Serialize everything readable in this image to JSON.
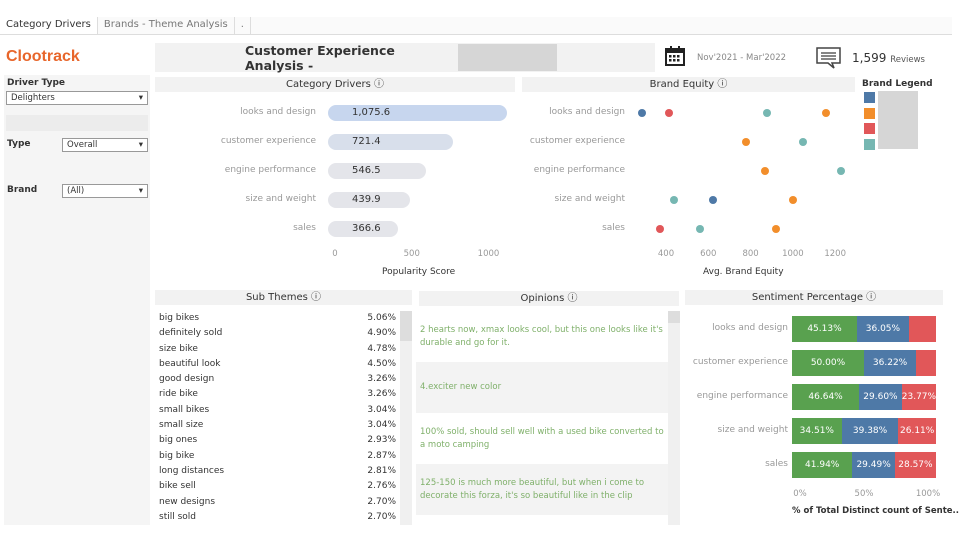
{
  "tabs": [
    {
      "label": "Category Drivers",
      "active": true
    },
    {
      "label": "Brands - Theme Analysis"
    },
    {
      "label": "."
    }
  ],
  "logo": "Clootrack",
  "filters": {
    "driver_type_label": "Driver Type",
    "driver_type_value": "Delighters",
    "type_label": "Type",
    "type_value": "Overall",
    "brand_label": "Brand",
    "brand_value": "(All)"
  },
  "header": {
    "title": "Customer Experience Analysis -",
    "date_range": "Nov'2021 - Mar'2022",
    "review_count": "1,599",
    "reviews_label": "Reviews"
  },
  "icons": {
    "calendar": "calendar-icon",
    "reviews": "speech-bubble-icon",
    "dropdown": "caret-down-icon",
    "info": "info-icon"
  },
  "colors": {
    "brand1": "#4e79a7",
    "brand2": "#f28e2b",
    "brand3": "#e15759",
    "brand4": "#76b7b2",
    "positive": "#59a14f",
    "neutral": "#4e79a7",
    "negative": "#e15759",
    "accent": "#e8662b"
  },
  "chart_data": [
    {
      "type": "bar",
      "title": "Category Drivers ⓘ",
      "categories": [
        "looks and design",
        "customer experience",
        "engine performance",
        "size and weight",
        "sales"
      ],
      "values": [
        1075.6,
        721.4,
        546.5,
        439.9,
        366.6
      ],
      "value_labels": [
        "1,075.6",
        "721.4",
        "546.5",
        "439.9",
        "366.6"
      ],
      "xlabel": "Popularity Score",
      "xticks": [
        "0",
        "500",
        "1000"
      ],
      "xlim": [
        0,
        1150
      ]
    },
    {
      "type": "scatter",
      "title": "Brand Equity ⓘ",
      "categories": [
        "looks and design",
        "customer experience",
        "engine performance",
        "size and weight",
        "sales"
      ],
      "xlabel": "Avg. Brand Equity",
      "xticks": [
        "400",
        "600",
        "800",
        "1000",
        "1200"
      ],
      "xlim": [
        290,
        1240
      ],
      "series": [
        {
          "color": "#4e79a7",
          "values": [
            287,
            null,
            null,
            622,
            null
          ]
        },
        {
          "color": "#f28e2b",
          "values": [
            1155,
            776,
            870,
            1000,
            920
          ]
        },
        {
          "color": "#e15759",
          "values": [
            415,
            null,
            null,
            null,
            372
          ]
        },
        {
          "color": "#76b7b2",
          "values": [
            877,
            1050,
            1229,
            438,
            560
          ]
        }
      ],
      "legend_title": "Brand Legend",
      "legend_colors": [
        "#4e79a7",
        "#f28e2b",
        "#e15759",
        "#76b7b2"
      ]
    },
    {
      "type": "bar",
      "stacked": true,
      "title": "Sentiment Percentage ⓘ",
      "categories": [
        "looks and design",
        "customer experience",
        "engine performance",
        "size and weight",
        "sales"
      ],
      "xlabel": "% of Total Distinct count of Sente..",
      "xticks": [
        "0%",
        "50%",
        "100%"
      ],
      "series": [
        {
          "color": "#59a14f",
          "values": [
            45.13,
            50.0,
            46.64,
            34.51,
            41.94
          ]
        },
        {
          "color": "#4e79a7",
          "values": [
            36.05,
            36.22,
            29.6,
            39.38,
            29.49
          ]
        },
        {
          "color": "#e15759",
          "values": [
            18.82,
            13.78,
            23.77,
            26.11,
            28.57
          ]
        }
      ],
      "labels": [
        [
          "45.13%",
          "36.05%",
          ""
        ],
        [
          "50.00%",
          "36.22%",
          ""
        ],
        [
          "46.64%",
          "29.60%",
          "23.77%"
        ],
        [
          "34.51%",
          "39.38%",
          "26.11%"
        ],
        [
          "41.94%",
          "29.49%",
          "28.57%"
        ]
      ]
    }
  ],
  "sub_themes": {
    "title": "Sub Themes ⓘ",
    "items": [
      {
        "name": "big bikes",
        "pct": "5.06%"
      },
      {
        "name": "definitely sold",
        "pct": "4.90%"
      },
      {
        "name": "size bike",
        "pct": "4.78%"
      },
      {
        "name": "beautiful look",
        "pct": "4.50%"
      },
      {
        "name": "good design",
        "pct": "3.26%"
      },
      {
        "name": "ride bike",
        "pct": "3.26%"
      },
      {
        "name": "small bikes",
        "pct": "3.04%"
      },
      {
        "name": "small size",
        "pct": "3.04%"
      },
      {
        "name": "big ones",
        "pct": "2.93%"
      },
      {
        "name": "big bike",
        "pct": "2.87%"
      },
      {
        "name": "long distances",
        "pct": "2.81%"
      },
      {
        "name": "bike sell",
        "pct": "2.76%"
      },
      {
        "name": "new designs",
        "pct": "2.70%"
      },
      {
        "name": "still sold",
        "pct": "2.70%"
      }
    ]
  },
  "opinions": {
    "title": "Opinions ⓘ",
    "items": [
      "2 hearts now, xmax looks cool, but this one looks like it's durable and go for it.",
      "4.exciter new color",
      "100% sold, should sell well with a used bike converted to a moto camping",
      "125-150 is much more beautiful, but when i come to decorate this forza, it's so beautiful like in the clip"
    ]
  }
}
